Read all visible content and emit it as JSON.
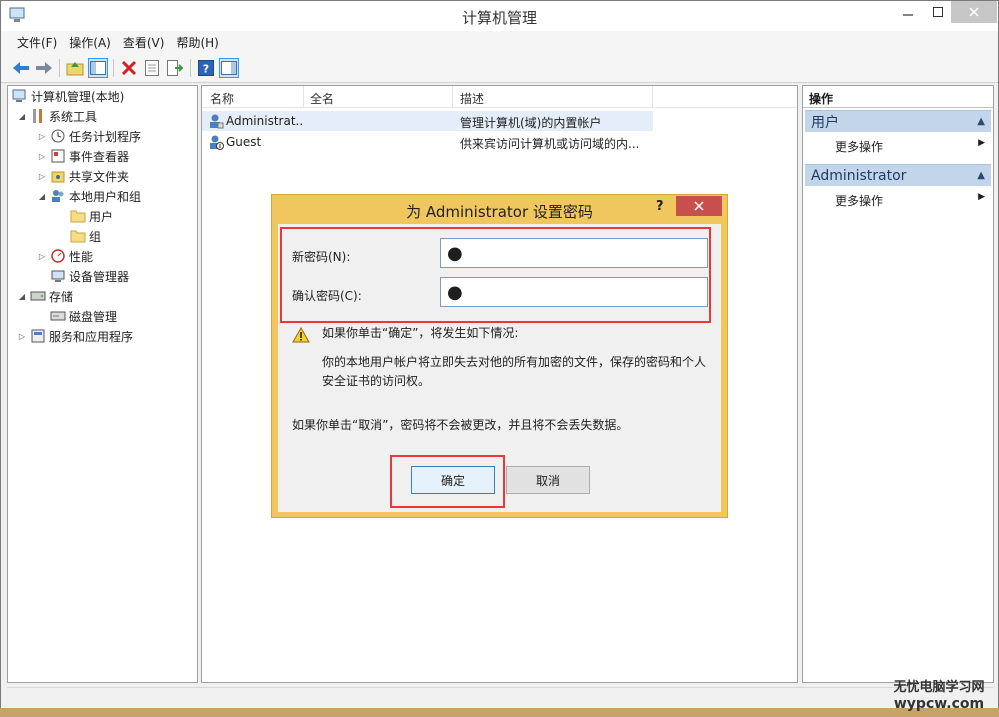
{
  "window": {
    "title": "计算机管理"
  },
  "menu": [
    "文件(F)",
    "操作(A)",
    "查看(V)",
    "帮助(H)"
  ],
  "tree": [
    {
      "label": "计算机管理(本地)",
      "icon": "computer-mgmt-icon"
    },
    {
      "label": "系统工具",
      "icon": "tools-icon"
    },
    {
      "label": "任务计划程序",
      "icon": "clock-icon"
    },
    {
      "label": "事件查看器",
      "icon": "event-viewer-icon"
    },
    {
      "label": "共享文件夹",
      "icon": "shared-folder-icon"
    },
    {
      "label": "本地用户和组",
      "icon": "users-groups-icon"
    },
    {
      "label": "用户",
      "icon": "folder-icon"
    },
    {
      "label": "组",
      "icon": "folder-icon"
    },
    {
      "label": "性能",
      "icon": "performance-icon"
    },
    {
      "label": "设备管理器",
      "icon": "device-manager-icon"
    },
    {
      "label": "存储",
      "icon": "storage-icon"
    },
    {
      "label": "磁盘管理",
      "icon": "disk-icon"
    },
    {
      "label": "服务和应用程序",
      "icon": "services-icon"
    }
  ],
  "list": {
    "columns": [
      "名称",
      "全名",
      "描述"
    ],
    "rows": [
      {
        "name": "Administrat...",
        "fullname": "",
        "desc": "管理计算机(域)的内置帐户"
      },
      {
        "name": "Guest",
        "fullname": "",
        "desc": "供来宾访问计算机或访问域的内..."
      }
    ]
  },
  "actions": {
    "title": "操作",
    "sections": [
      {
        "label": "用户",
        "item": "更多操作"
      },
      {
        "label": "Administrator",
        "item": "更多操作"
      }
    ]
  },
  "dialog": {
    "title": "为 Administrator 设置密码",
    "help": "?",
    "new_password_label": "新密码(N):",
    "new_password_value": "●",
    "confirm_password_label": "确认密码(C):",
    "confirm_password_value": "●",
    "warning_line1": "如果你单击“确定”，将发生如下情况:",
    "warning_line2": "你的本地用户帐户将立即失去对他的所有加密的文件，保存的密码和个人",
    "warning_line3": "安全证书的访问权。",
    "cancel_note": "如果你单击“取消”，密码将不会被更改，并且将不会丢失数据。",
    "ok_label": "确定",
    "cancel_label": "取消"
  },
  "watermark": {
    "line1": "无忧电脑学习网",
    "line2": "wypcw.com"
  },
  "colors": {
    "highlight_red": "#e8393a",
    "dialog_frame": "#f0c75e",
    "action_header": "#c3d5ea"
  }
}
